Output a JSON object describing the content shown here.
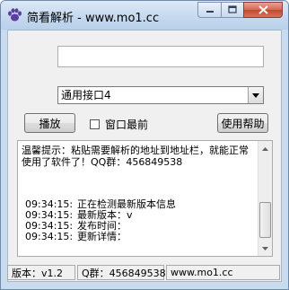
{
  "titlebar": {
    "title": "简看解析 - www.mo1.cc",
    "icon": "paw-icon"
  },
  "colors": {
    "window_frame": "#c9dcef",
    "close_button": "#c2472f",
    "app_icon": "#5a3fa0"
  },
  "form": {
    "url_input_value": "",
    "interface_selected": "通用接口4",
    "play_label": "播放",
    "topmost_label": "窗口最前",
    "topmost_checked": false,
    "help_label": "使用帮助"
  },
  "log": {
    "notice": "温馨提示：粘贴需要解析的地址到地址栏，就能正常使用了软件了！QQ群：456849538",
    "lines": [
      {
        "time": "09:34:15:",
        "text": "正在检测最新版本信息"
      },
      {
        "time": "09:34:15:",
        "text": "最新版本：v"
      },
      {
        "time": "09:34:15:",
        "text": "发布时间："
      },
      {
        "time": "09:34:15:",
        "text": "更新详情："
      }
    ]
  },
  "statusbar": {
    "version": "版本：v1.2",
    "qq_group": "Q群：456849538",
    "site": "www.mo1.cc"
  }
}
